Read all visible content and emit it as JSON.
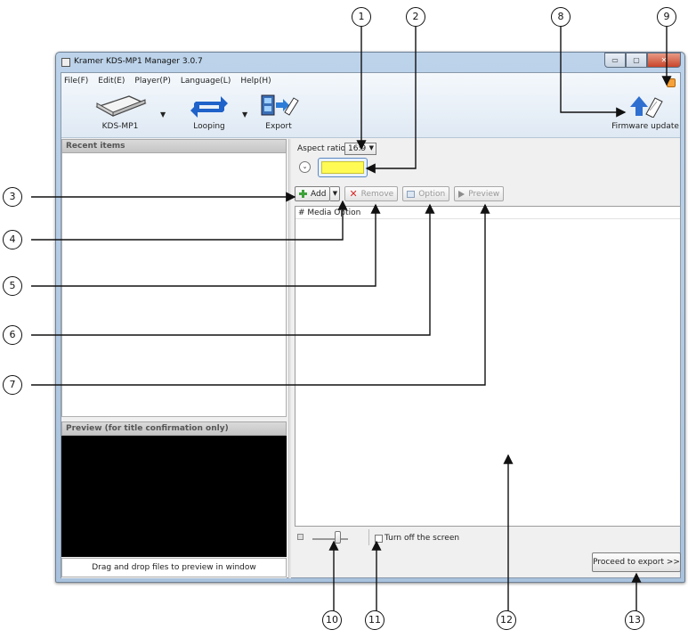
{
  "window": {
    "title": "Kramer KDS-MP1 Manager 3.0.7",
    "minimize_glyph": "▭",
    "maximize_glyph": "▢",
    "close_glyph": "✕"
  },
  "menu": [
    "File(F)",
    "Edit(E)",
    "Player(P)",
    "Language(L)",
    "Help(H)"
  ],
  "toolbar": {
    "device_label": "KDS-MP1",
    "looping_label": "Looping",
    "export_label": "Export",
    "firmware_label": "Firmware update",
    "dropdown_glyph": "▼"
  },
  "left_panel": {
    "recent_title": "Recent items",
    "preview_title": "Preview (for title confirmation only)",
    "drag_hint": "Drag and drop files to preview in window"
  },
  "right_panel": {
    "aspect_label": "Aspect ratio",
    "aspect_value": "16:9",
    "expander_glyph": "⌄",
    "buttons": {
      "add": "Add",
      "remove": "Remove",
      "option": "Option",
      "preview": "Preview"
    },
    "list_header": "# Media Option",
    "volume_percent": 75,
    "turn_off_label": "Turn off the screen",
    "proceed_label": "Proceed to export >>"
  },
  "callouts": [
    "1",
    "2",
    "3",
    "4",
    "5",
    "6",
    "7",
    "8",
    "9",
    "10",
    "11",
    "12",
    "13"
  ],
  "colors": {
    "swatch": "#fffb54",
    "close": "#c9452b",
    "accent": "#3da23a"
  }
}
